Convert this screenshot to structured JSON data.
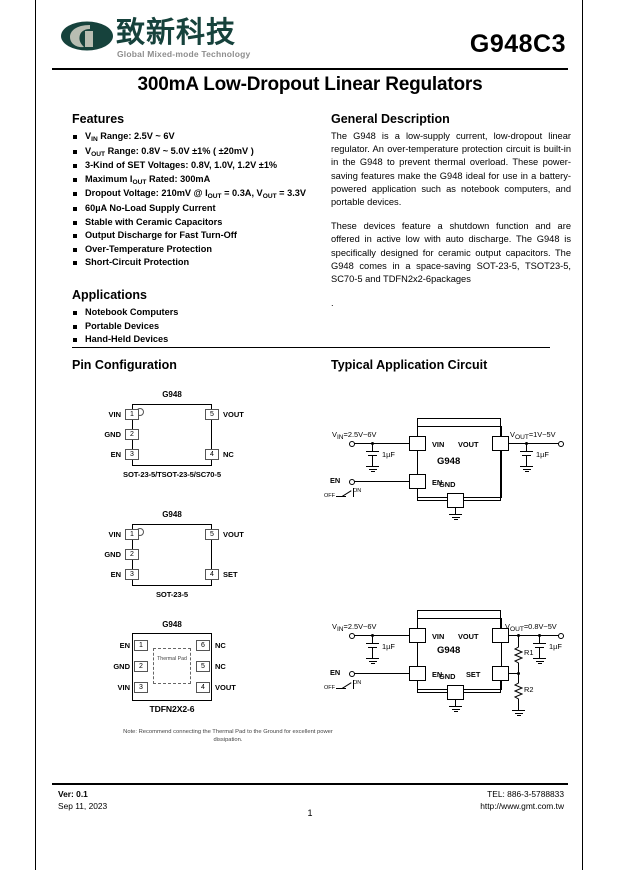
{
  "header": {
    "logo_cn": "致新科技",
    "logo_en": "Global Mixed-mode Technology",
    "part_number": "G948C3",
    "doc_title": "300mA Low-Dropout Linear Regulators"
  },
  "features": {
    "title": "Features",
    "items": [
      "V|IN| Range: 2.5V ~ 6V",
      "V|OUT| Range: 0.8V ~ 5.0V ±1% ( ±20mV )",
      "3-Kind of SET Voltages: 0.8V, 1.0V, 1.2V ±1%",
      "Maximum I|OUT| Rated: 300mA",
      "Dropout Voltage: 210mV @ I|OUT| = 0.3A, V|OUT| = 3.3V",
      "60µA No-Load Supply Current",
      "Stable with Ceramic Capacitors",
      "Output Discharge for Fast Turn-Off",
      "Over-Temperature Protection",
      "Short-Circuit Protection"
    ]
  },
  "applications": {
    "title": "Applications",
    "items": [
      "Notebook Computers",
      "Portable Devices",
      "Hand-Held Devices"
    ]
  },
  "general_description": {
    "title": "General Description",
    "paragraph1": "The G948 is a low-supply current, low-dropout linear regulator. An over-temperature protection circuit is built-in in the G948 to prevent thermal overload. These power-saving features make the G948 ideal for use in a battery-powered application such as notebook computers, and portable devices.",
    "paragraph2": "These devices feature a shutdown function and are offered in active low with auto discharge. The G948 is specifically designed for ceramic output capacitors. The G948 comes in a space-saving SOT-23-5, TSOT23-5, SC70-5 and TDFN2x2-6packages",
    "stub": "."
  },
  "pin_configuration": {
    "title": "Pin Configuration",
    "packages": [
      {
        "chip_label": "G948",
        "package_name": "SOT-23-5/TSOT-23-5/SC70-5",
        "left_pins": [
          {
            "num": "1",
            "name": "VIN"
          },
          {
            "num": "2",
            "name": "GND"
          },
          {
            "num": "3",
            "name": "EN"
          }
        ],
        "right_pins": [
          {
            "num": "5",
            "name": "VOUT"
          },
          {
            "num": "4",
            "name": "NC"
          }
        ]
      },
      {
        "chip_label": "G948",
        "package_name": "SOT-23-5",
        "left_pins": [
          {
            "num": "1",
            "name": "VIN"
          },
          {
            "num": "2",
            "name": "GND"
          },
          {
            "num": "3",
            "name": "EN"
          }
        ],
        "right_pins": [
          {
            "num": "5",
            "name": "VOUT"
          },
          {
            "num": "4",
            "name": "SET"
          }
        ]
      },
      {
        "chip_label": "G948",
        "package_name": "TDFN2X2-6",
        "thermal_pad_label": "Thermal Pad",
        "left_pins": [
          {
            "num": "1",
            "name": "EN"
          },
          {
            "num": "2",
            "name": "GND"
          },
          {
            "num": "3",
            "name": "VIN"
          }
        ],
        "right_pins": [
          {
            "num": "6",
            "name": "NC"
          },
          {
            "num": "5",
            "name": "NC"
          },
          {
            "num": "4",
            "name": "VOUT"
          }
        ]
      }
    ],
    "note": "Note: Recommend connecting the Thermal Pad  to the Ground for excellent power dissipation."
  },
  "application_circuit": {
    "title": "Typical Application Circuit",
    "circuits": [
      {
        "ic_name": "G948",
        "vin_label": "V|IN|=2.5V~6V",
        "vout_label": "V|OUT|=1V~5V",
        "cin_label": "1µF",
        "cout_label": "1µF",
        "en_label": "EN",
        "off_label": "OFF",
        "on_label": "ON",
        "pins": {
          "vin": "VIN",
          "vout": "VOUT",
          "en": "EN",
          "gnd": "GND"
        }
      },
      {
        "ic_name": "G948",
        "vin_label": "V|IN|=2.5V~6V",
        "vout_label": "V|OUT|=0.8V~5V",
        "cin_label": "1µF",
        "cout_label": "1µF",
        "en_label": "EN",
        "off_label": "OFF",
        "on_label": "ON",
        "r1_label": "R1",
        "r2_label": "R2",
        "pins": {
          "vin": "VIN",
          "vout": "VOUT",
          "en": "EN",
          "gnd": "GND",
          "set": "SET"
        }
      }
    ]
  },
  "footer": {
    "version": "Ver: 0.1",
    "date": "Sep 11, 2023",
    "tel": "TEL: 886-3-5788833",
    "url": "http://www.gmt.com.tw",
    "page_number": "1"
  },
  "colors": {
    "logo_green": "#16423c",
    "logo_gray": "#8d8d8d",
    "text": "#000000"
  }
}
